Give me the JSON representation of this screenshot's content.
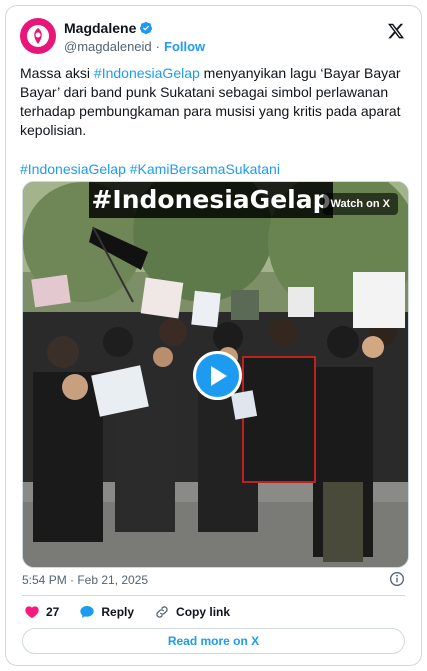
{
  "author": {
    "name": "Magdalene",
    "handle": "@magdaleneid",
    "follow_label": "Follow",
    "avatar_color": "#e8157a"
  },
  "tweet": {
    "text_parts": [
      "Massa aksi ",
      "#IndonesiaGelap",
      " menyanyikan lagu ‘Bayar Bayar Bayar’ dari band punk Sukatani sebagai simbol perlawanan terhadap pembungkaman para musisi yang kritis pada aparat kepolisian."
    ],
    "hashtags": [
      "#IndonesiaGelap",
      "#KamiBersamaSukatani"
    ]
  },
  "media": {
    "overlay_title": "#IndonesiaGelap",
    "watch_label": "Watch on X"
  },
  "meta": {
    "timestamp": "5:54 PM · Feb 21, 2025"
  },
  "actions": {
    "likes": "27",
    "reply_label": "Reply",
    "copy_label": "Copy link"
  },
  "read_more_label": "Read more on X",
  "colors": {
    "accent": "#1d9bf0",
    "like": "#f91880",
    "text": "#0f1419",
    "muted": "#536471"
  }
}
